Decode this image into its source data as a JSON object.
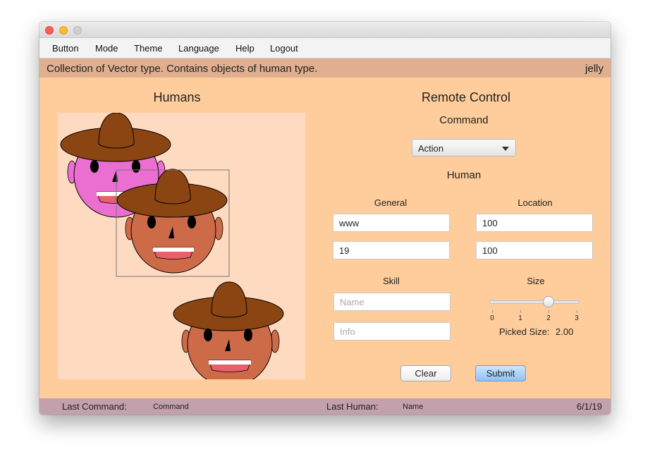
{
  "menu": [
    "Button",
    "Mode",
    "Theme",
    "Language",
    "Help",
    "Logout"
  ],
  "info": {
    "text": "Collection of Vector type. Contains objects of human type.",
    "user": "jelly"
  },
  "left": {
    "title": "Humans"
  },
  "right": {
    "title": "Remote Control",
    "command_label": "Command",
    "command_value": "Action",
    "human_label": "Human",
    "general_label": "General",
    "general_name": "www",
    "general_age": "19",
    "location_label": "Location",
    "location_x": "100",
    "location_y": "100",
    "skill_label": "Skill",
    "skill_name_placeholder": "Name",
    "skill_info_placeholder": "Info",
    "size_label": "Size",
    "size_ticks": [
      "0",
      "1",
      "2",
      "3"
    ],
    "size_value": 2.0,
    "size_max": 3,
    "picked_size_label": "Picked Size:",
    "picked_size_value": "2.00",
    "clear_label": "Clear",
    "submit_label": "Submit"
  },
  "status": {
    "last_command_label": "Last Command:",
    "last_command_value": "Command",
    "last_human_label": "Last Human:",
    "last_human_value": "Name",
    "date": "6/1/19"
  },
  "colors": {
    "background": "#fecd9b",
    "info_bar": "#dfaf90",
    "status_bar": "#c3a1ac",
    "canvas": "#fedbc0",
    "hat": "#8b4513",
    "face_pink": "#ea6fd1",
    "face_brown": "#cd6b48",
    "mouth": "#e8606a"
  },
  "humans": [
    {
      "face": "pink",
      "selected": false
    },
    {
      "face": "brown",
      "selected": true
    },
    {
      "face": "brown",
      "selected": false
    }
  ]
}
